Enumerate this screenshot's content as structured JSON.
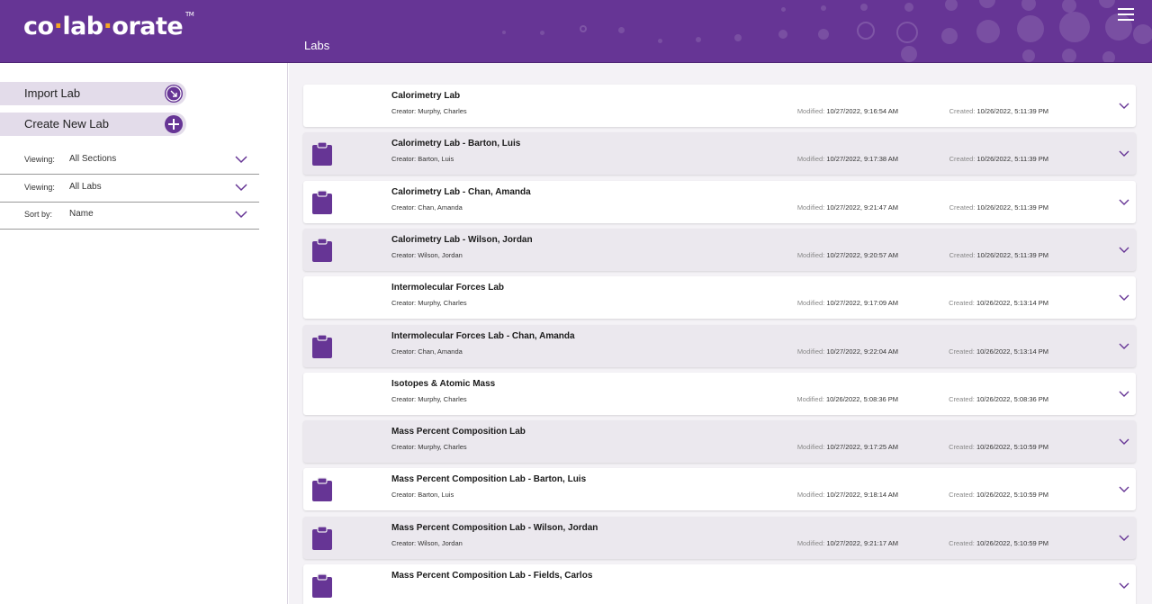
{
  "header": {
    "logo_pre": "co",
    "logo_sep1": "·",
    "logo_mid": "lab",
    "logo_sep2": "·",
    "logo_post": "orate",
    "logo_tm": "TM",
    "title": "Labs",
    "menu_icon": "hamburger-menu-icon"
  },
  "sidebar": {
    "import_label": "Import Lab",
    "create_label": "Create New Lab",
    "filters": [
      {
        "label": "Viewing:",
        "value": "All Sections"
      },
      {
        "label": "Viewing:",
        "value": "All Labs"
      },
      {
        "label": "Sort by:",
        "value": "Name"
      }
    ]
  },
  "labels": {
    "creator": "Creator:",
    "modified": "Modified:",
    "created": "Created:"
  },
  "labs": [
    {
      "name": "Calorimetry Lab",
      "creator": "Murphy, Charles",
      "modified": "10/27/2022, 9:16:54 AM",
      "created": "10/26/2022, 5:11:39 PM",
      "clipboard": false
    },
    {
      "name": "Calorimetry Lab - Barton, Luis",
      "creator": "Barton, Luis",
      "modified": "10/27/2022, 9:17:38 AM",
      "created": "10/26/2022, 5:11:39 PM",
      "clipboard": true
    },
    {
      "name": "Calorimetry Lab - Chan, Amanda",
      "creator": "Chan, Amanda",
      "modified": "10/27/2022, 9:21:47 AM",
      "created": "10/26/2022, 5:11:39 PM",
      "clipboard": true
    },
    {
      "name": "Calorimetry Lab - Wilson, Jordan",
      "creator": "Wilson, Jordan",
      "modified": "10/27/2022, 9:20:57 AM",
      "created": "10/26/2022, 5:11:39 PM",
      "clipboard": true
    },
    {
      "name": "Intermolecular Forces Lab",
      "creator": "Murphy, Charles",
      "modified": "10/27/2022, 9:17:09 AM",
      "created": "10/26/2022, 5:13:14 PM",
      "clipboard": false
    },
    {
      "name": "Intermolecular Forces Lab - Chan, Amanda",
      "creator": "Chan, Amanda",
      "modified": "10/27/2022, 9:22:04 AM",
      "created": "10/26/2022, 5:13:14 PM",
      "clipboard": true
    },
    {
      "name": "Isotopes & Atomic Mass",
      "creator": "Murphy, Charles",
      "modified": "10/26/2022, 5:08:36 PM",
      "created": "10/26/2022, 5:08:36 PM",
      "clipboard": false
    },
    {
      "name": "Mass Percent Composition Lab",
      "creator": "Murphy, Charles",
      "modified": "10/27/2022, 9:17:25 AM",
      "created": "10/26/2022, 5:10:59 PM",
      "clipboard": false
    },
    {
      "name": "Mass Percent Composition Lab - Barton, Luis",
      "creator": "Barton, Luis",
      "modified": "10/27/2022, 9:18:14 AM",
      "created": "10/26/2022, 5:10:59 PM",
      "clipboard": true
    },
    {
      "name": "Mass Percent Composition Lab - Wilson, Jordan",
      "creator": "Wilson, Jordan",
      "modified": "10/27/2022, 9:21:17 AM",
      "created": "10/26/2022, 5:10:59 PM",
      "clipboard": true
    },
    {
      "name": "Mass Percent Composition Lab - Fields, Carlos",
      "creator": "",
      "modified": "",
      "created": "",
      "clipboard": true
    }
  ],
  "colors": {
    "brand": "#663595",
    "accent": "#f5a623",
    "row_alt": "#ebe8ee"
  }
}
